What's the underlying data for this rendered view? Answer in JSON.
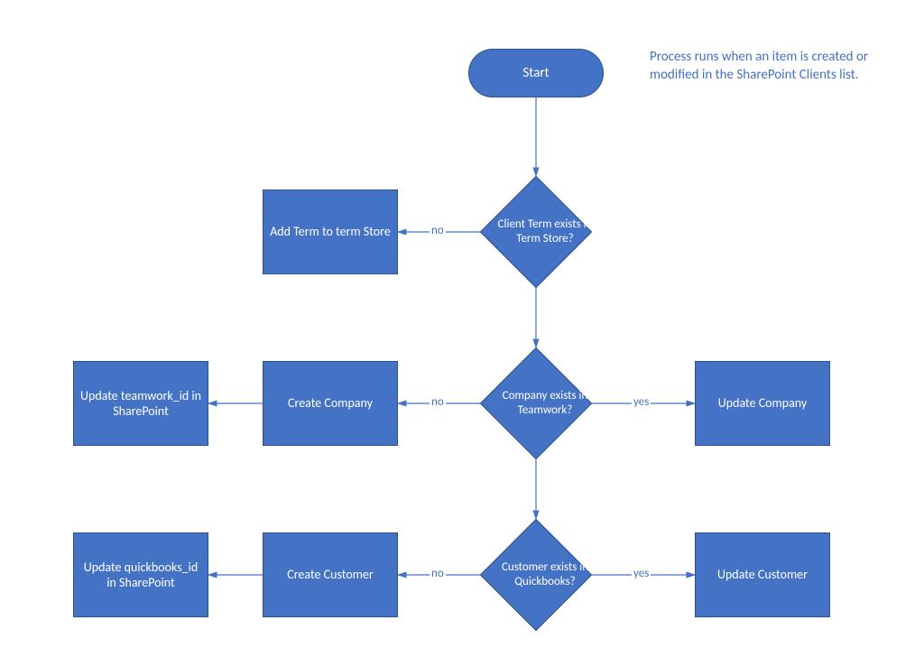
{
  "chart_data": {
    "type": "flowchart",
    "title": "",
    "annotation": "Process runs when an item is created or modified in the SharePoint Clients list.",
    "nodes": [
      {
        "id": "start",
        "type": "terminator",
        "label": "Start"
      },
      {
        "id": "d_term",
        "type": "decision",
        "label": "Client Term exists in Term Store?"
      },
      {
        "id": "p_addterm",
        "type": "process",
        "label": "Add Term to term Store"
      },
      {
        "id": "d_teamwork",
        "type": "decision",
        "label": "Company exists in Teamwork?"
      },
      {
        "id": "p_createco",
        "type": "process",
        "label": "Create Company"
      },
      {
        "id": "p_updteamid",
        "type": "process",
        "label": "Update teamwork_id in SharePoint"
      },
      {
        "id": "p_updateco",
        "type": "process",
        "label": "Update Company"
      },
      {
        "id": "d_qb",
        "type": "decision",
        "label": "Customer exists in Quickbooks?"
      },
      {
        "id": "p_createcust",
        "type": "process",
        "label": "Create Customer"
      },
      {
        "id": "p_updqbid",
        "type": "process",
        "label": "Update quickbooks_id in SharePoint"
      },
      {
        "id": "p_updatecust",
        "type": "process",
        "label": "Update Customer"
      }
    ],
    "edges": [
      {
        "from": "start",
        "to": "d_term",
        "label": ""
      },
      {
        "from": "d_term",
        "to": "p_addterm",
        "label": "no"
      },
      {
        "from": "d_term",
        "to": "d_teamwork",
        "label": ""
      },
      {
        "from": "d_teamwork",
        "to": "p_createco",
        "label": "no"
      },
      {
        "from": "d_teamwork",
        "to": "p_updateco",
        "label": "yes"
      },
      {
        "from": "p_createco",
        "to": "p_updteamid",
        "label": ""
      },
      {
        "from": "d_teamwork",
        "to": "d_qb",
        "label": ""
      },
      {
        "from": "d_qb",
        "to": "p_createcust",
        "label": "no"
      },
      {
        "from": "d_qb",
        "to": "p_updatecust",
        "label": "yes"
      },
      {
        "from": "p_createcust",
        "to": "p_updqbid",
        "label": ""
      }
    ],
    "labels": {
      "no": "no",
      "yes": "yes"
    }
  },
  "colors": {
    "shape_fill": "#4472C4",
    "shape_border": "#2F528F",
    "text": "#FFFFFF",
    "annotation": "#4472C4"
  }
}
